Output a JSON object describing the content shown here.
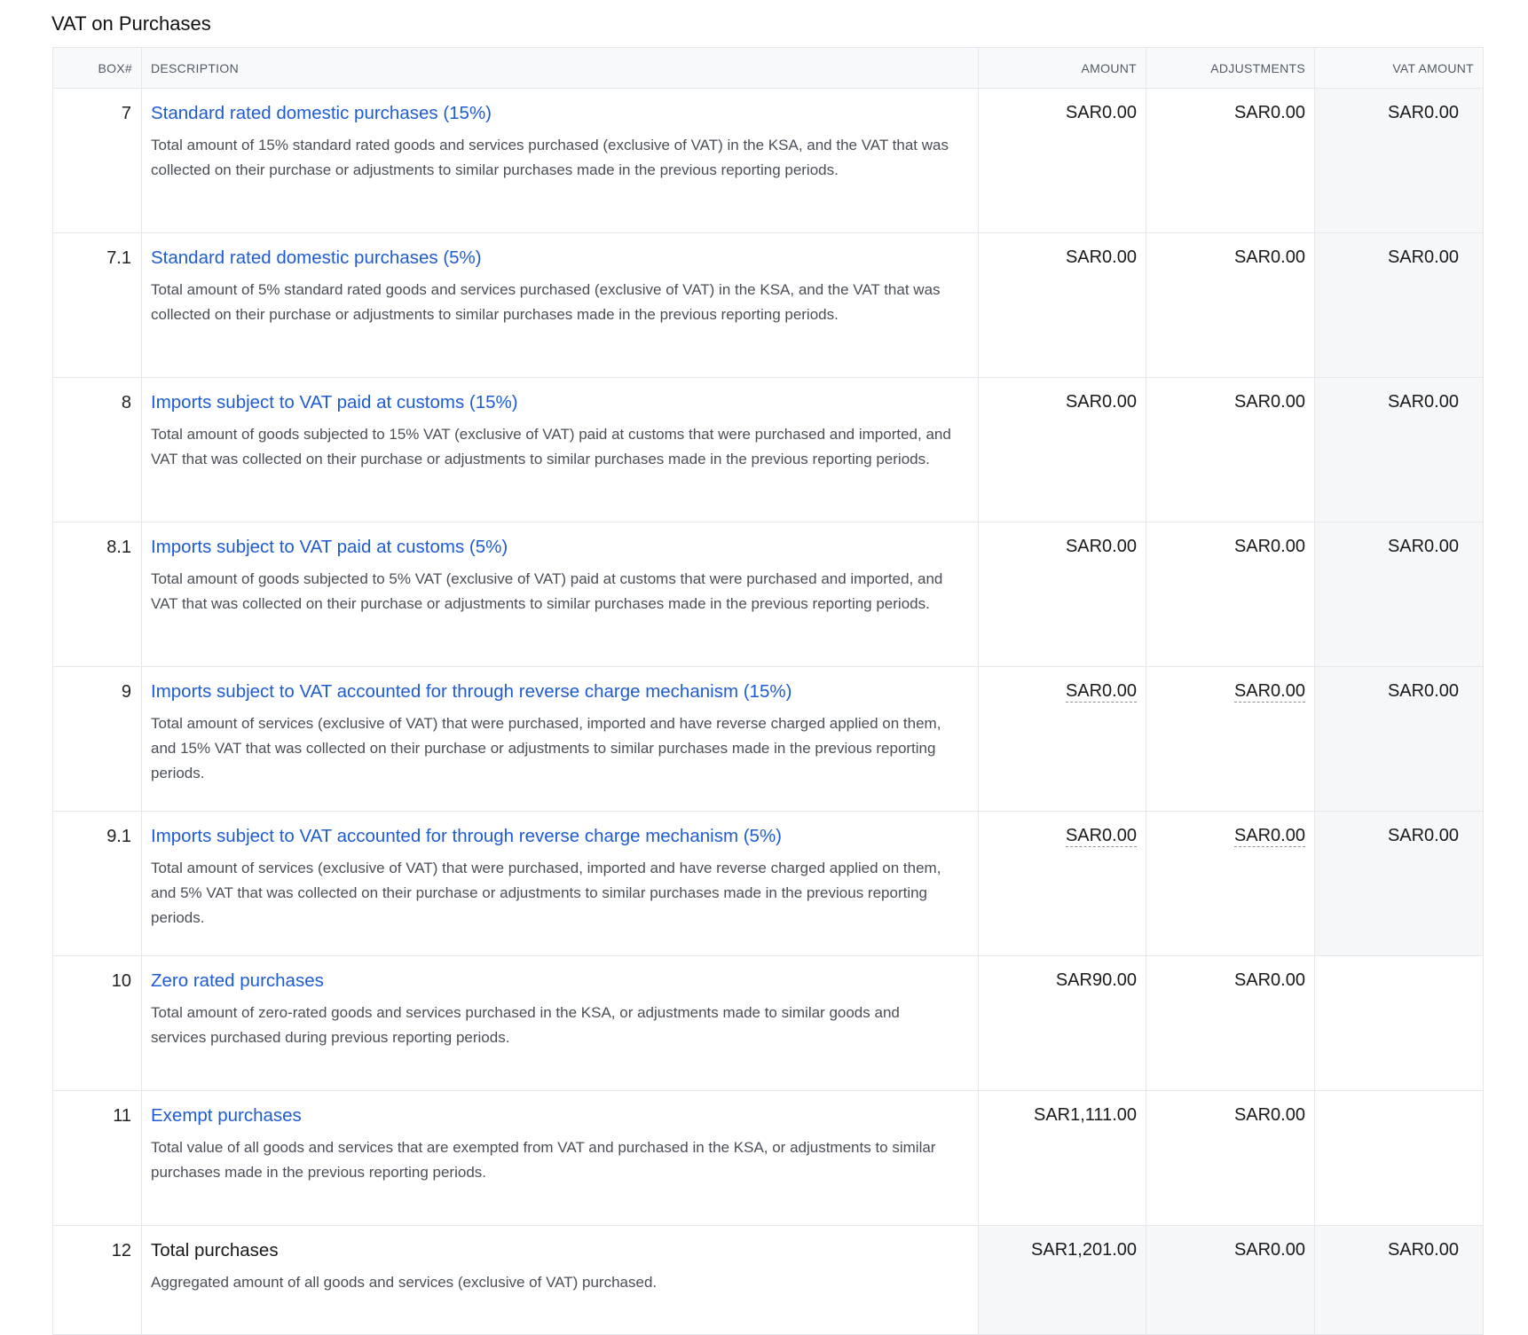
{
  "section": {
    "title": "VAT on Purchases"
  },
  "table": {
    "headers": {
      "box": "BOX#",
      "description": "DESCRIPTION",
      "amount": "AMOUNT",
      "adjustments": "ADJUSTMENTS",
      "vat_amount": "VAT AMOUNT"
    },
    "rows": [
      {
        "box": "7",
        "title": "Standard rated domestic purchases (15%)",
        "description": "Total amount of 15% standard rated goods and services purchased (exclusive of VAT) in the KSA, and the VAT that was collected on their purchase or adjustments to similar purchases made in the previous reporting periods.",
        "amount": "SAR0.00",
        "adjustments": "SAR0.00",
        "vat_amount": "SAR0.00"
      },
      {
        "box": "7.1",
        "title": "Standard rated domestic purchases (5%)",
        "description": "Total amount of 5% standard rated goods and services purchased (exclusive of VAT) in the KSA, and the VAT that was collected on their purchase or adjustments to similar purchases made in the previous reporting periods.",
        "amount": "SAR0.00",
        "adjustments": "SAR0.00",
        "vat_amount": "SAR0.00"
      },
      {
        "box": "8",
        "title": "Imports subject to VAT paid at customs (15%)",
        "description": "Total amount of goods subjected to 15% VAT (exclusive of VAT) paid at customs that were purchased and imported, and VAT that was collected on their purchase or adjustments to similar purchases made in the previous reporting periods.",
        "amount": "SAR0.00",
        "adjustments": "SAR0.00",
        "vat_amount": "SAR0.00"
      },
      {
        "box": "8.1",
        "title": "Imports subject to VAT paid at customs (5%)",
        "description": "Total amount of goods subjected to 5% VAT (exclusive of VAT) paid at customs that were purchased and imported, and VAT that was collected on their purchase or adjustments to similar purchases made in the previous reporting periods.",
        "amount": "SAR0.00",
        "adjustments": "SAR0.00",
        "vat_amount": "SAR0.00"
      },
      {
        "box": "9",
        "title": "Imports subject to VAT accounted for through reverse charge mechanism (15%)",
        "description": "Total amount of services (exclusive of VAT) that were purchased, imported and have reverse charged applied on them, and 15% VAT that was collected on their purchase or adjustments to similar purchases made in the previous reporting periods.",
        "amount": "SAR0.00",
        "adjustments": "SAR0.00",
        "vat_amount": "SAR0.00"
      },
      {
        "box": "9.1",
        "title": "Imports subject to VAT accounted for through reverse charge mechanism (5%)",
        "description": "Total amount of services (exclusive of VAT) that were purchased, imported and have reverse charged applied on them, and 5% VAT that was collected on their purchase or adjustments to similar purchases made in the previous reporting periods.",
        "amount": "SAR0.00",
        "adjustments": "SAR0.00",
        "vat_amount": "SAR0.00"
      },
      {
        "box": "10",
        "title": "Zero rated purchases",
        "description": "Total amount of zero-rated goods and services purchased in the KSA, or adjustments made to similar goods and services purchased during previous reporting periods.",
        "amount": "SAR90.00",
        "adjustments": "SAR0.00",
        "vat_amount": ""
      },
      {
        "box": "11",
        "title": "Exempt purchases",
        "description": "Total value of all goods and services that are exempted from VAT and purchased in the KSA, or adjustments to similar purchases made in the previous reporting periods.",
        "amount": "SAR1,111.00",
        "adjustments": "SAR0.00",
        "vat_amount": ""
      },
      {
        "box": "12",
        "title": "Total purchases",
        "description": "Aggregated amount of all goods and services (exclusive of VAT) purchased.",
        "amount": "SAR1,201.00",
        "adjustments": "SAR0.00",
        "vat_amount": "SAR0.00"
      }
    ]
  }
}
